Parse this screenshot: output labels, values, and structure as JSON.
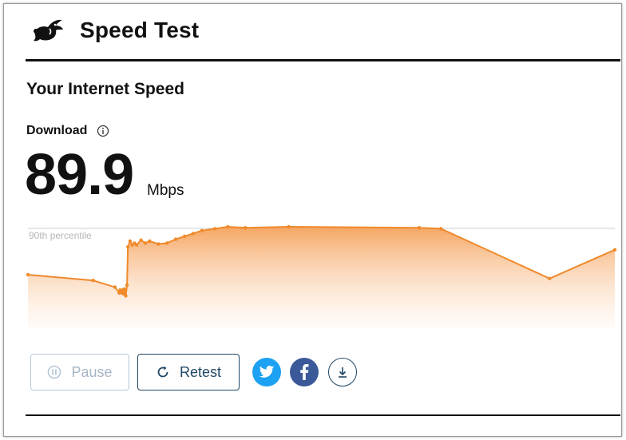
{
  "app": {
    "title": "Speed Test"
  },
  "section": {
    "title": "Your Internet Speed"
  },
  "metric": {
    "label": "Download",
    "value": "89.9",
    "unit": "Mbps"
  },
  "chart_data": {
    "type": "area",
    "annotation": "90th percentile",
    "accent_color": "#f08a2c",
    "x": [
      0,
      1.5,
      2.0,
      2.1,
      2.12,
      2.15,
      2.18,
      2.2,
      2.22,
      2.25,
      2.28,
      2.3,
      2.35,
      2.4,
      2.45,
      2.5,
      2.6,
      2.7,
      2.8,
      3.0,
      3.2,
      3.4,
      3.6,
      3.8,
      4.0,
      4.3,
      4.6,
      5.0,
      6.0,
      9.0,
      9.5,
      12.0,
      13.5
    ],
    "values": [
      55,
      49,
      42,
      36,
      39,
      36,
      39,
      35,
      40,
      33,
      44,
      84,
      90,
      86,
      88,
      86,
      91,
      88,
      90,
      87,
      88,
      92,
      95,
      98,
      101,
      103,
      105,
      104,
      105,
      104,
      103,
      51,
      81
    ]
  },
  "buttons": {
    "pause": "Pause",
    "retest": "Retest"
  },
  "social": {
    "twitter_icon": "twitter-icon",
    "facebook_icon": "facebook-icon",
    "download_icon": "download-icon"
  },
  "colors": {
    "twitter": "#1da1f2",
    "facebook": "#3b5998",
    "retest": "#1f4766",
    "pause": "#b7c7d6"
  }
}
